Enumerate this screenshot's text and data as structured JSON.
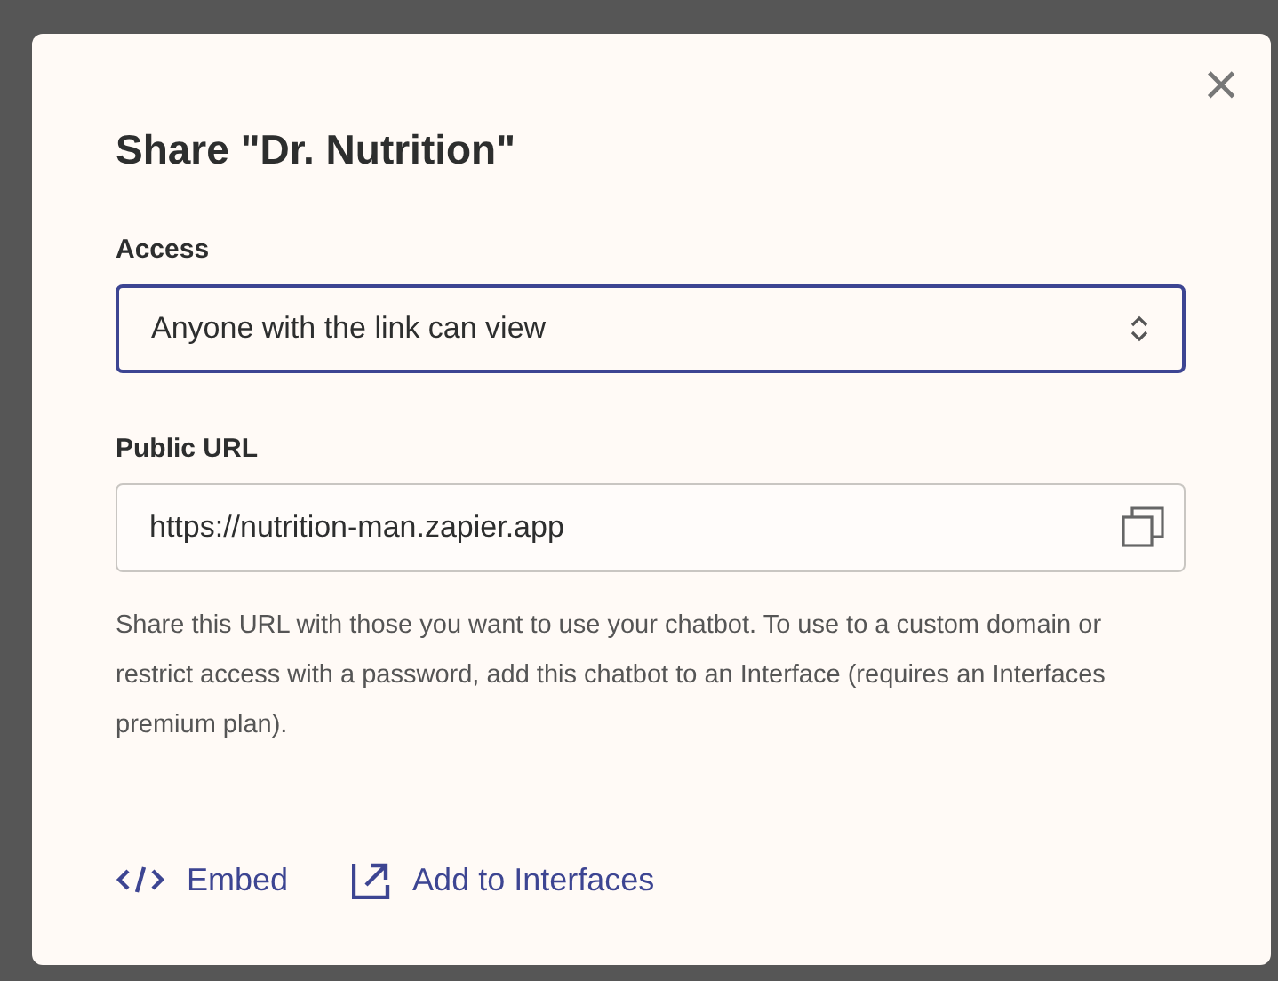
{
  "dialog": {
    "title": "Share \"Dr. Nutrition\"",
    "close": "×"
  },
  "access": {
    "label": "Access",
    "value": "Anyone with the link can view"
  },
  "public_url": {
    "label": "Public URL",
    "value": "https://nutrition-man.zapier.app"
  },
  "help_text": "Share this URL with those you want to use your chatbot. To use to a custom domain or restrict access with a password, add this chatbot to an Interface (requires an Interfaces premium plan).",
  "actions": [
    {
      "kind": "embed",
      "label": "Embed"
    },
    {
      "kind": "external",
      "label": "Add to Interfaces"
    }
  ]
}
